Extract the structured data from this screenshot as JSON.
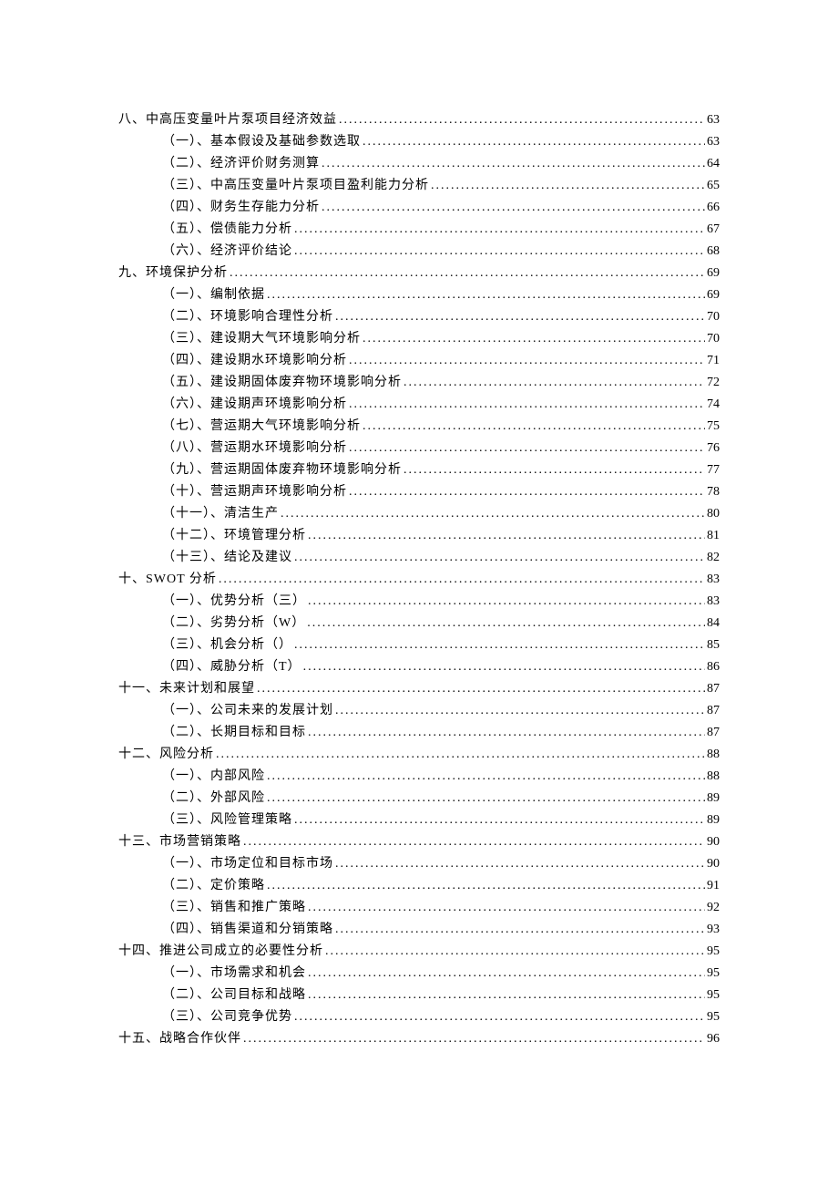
{
  "toc": [
    {
      "level": 1,
      "label": "八、中高压变量叶片泵项目经济效益",
      "page": "63"
    },
    {
      "level": 2,
      "label": "（一）、基本假设及基础参数选取",
      "page": "63"
    },
    {
      "level": 2,
      "label": "（二）、经济评价财务测算",
      "page": "64"
    },
    {
      "level": 2,
      "label": "（三）、中高压变量叶片泵项目盈利能力分析",
      "page": "65"
    },
    {
      "level": 2,
      "label": "（四）、财务生存能力分析",
      "page": "66"
    },
    {
      "level": 2,
      "label": "（五）、偿债能力分析",
      "page": "67"
    },
    {
      "level": 2,
      "label": "（六）、经济评价结论",
      "page": "68"
    },
    {
      "level": 1,
      "label": "九、环境保护分析",
      "page": "69"
    },
    {
      "level": 2,
      "label": "（一）、编制依据",
      "page": "69"
    },
    {
      "level": 2,
      "label": "（二）、环境影响合理性分析",
      "page": "70"
    },
    {
      "level": 2,
      "label": "（三）、建设期大气环境影响分析",
      "page": "70"
    },
    {
      "level": 2,
      "label": "（四）、建设期水环境影响分析",
      "page": "71"
    },
    {
      "level": 2,
      "label": "（五）、建设期固体废弃物环境影响分析",
      "page": "72"
    },
    {
      "level": 2,
      "label": "（六）、建设期声环境影响分析",
      "page": "74"
    },
    {
      "level": 2,
      "label": "（七）、营运期大气环境影响分析",
      "page": "75"
    },
    {
      "level": 2,
      "label": "（八）、营运期水环境影响分析",
      "page": "76"
    },
    {
      "level": 2,
      "label": "（九）、营运期固体废弃物环境影响分析",
      "page": "77"
    },
    {
      "level": 2,
      "label": "（十）、营运期声环境影响分析",
      "page": "78"
    },
    {
      "level": 2,
      "label": "（十一）、清洁生产",
      "page": "80"
    },
    {
      "level": 2,
      "label": "（十二）、环境管理分析",
      "page": "81"
    },
    {
      "level": 2,
      "label": "（十三）、结论及建议",
      "page": "82"
    },
    {
      "level": 1,
      "label": "十、SWOT 分析",
      "page": "83"
    },
    {
      "level": 2,
      "label": "（一）、优势分析（三）",
      "page": "83"
    },
    {
      "level": 2,
      "label": "（二）、劣势分析（W）",
      "page": "84"
    },
    {
      "level": 2,
      "label": "（三）、机会分析（）",
      "page": "85"
    },
    {
      "level": 2,
      "label": "（四）、威胁分析（T）",
      "page": "86"
    },
    {
      "level": 1,
      "label": "十一、未来计划和展望",
      "page": "87"
    },
    {
      "level": 2,
      "label": "（一）、公司未来的发展计划",
      "page": "87"
    },
    {
      "level": 2,
      "label": "（二）、长期目标和目标",
      "page": "87"
    },
    {
      "level": 1,
      "label": "十二、风险分析",
      "page": "88"
    },
    {
      "level": 2,
      "label": "（一）、内部风险",
      "page": "88"
    },
    {
      "level": 2,
      "label": "（二）、外部风险",
      "page": "89"
    },
    {
      "level": 2,
      "label": "（三）、风险管理策略",
      "page": "89"
    },
    {
      "level": 1,
      "label": "十三、市场营销策略",
      "page": "90"
    },
    {
      "level": 2,
      "label": "（一）、市场定位和目标市场",
      "page": "90"
    },
    {
      "level": 2,
      "label": "（二）、定价策略",
      "page": "91"
    },
    {
      "level": 2,
      "label": "（三）、销售和推广策略",
      "page": "92"
    },
    {
      "level": 2,
      "label": "（四）、销售渠道和分销策略",
      "page": "93"
    },
    {
      "level": 1,
      "label": "十四、推进公司成立的必要性分析",
      "page": "95"
    },
    {
      "level": 2,
      "label": "（一）、市场需求和机会",
      "page": "95"
    },
    {
      "level": 2,
      "label": "（二）、公司目标和战略",
      "page": "95"
    },
    {
      "level": 2,
      "label": "（三）、公司竞争优势",
      "page": "95"
    },
    {
      "level": 1,
      "label": "十五、战略合作伙伴",
      "page": "96"
    }
  ]
}
